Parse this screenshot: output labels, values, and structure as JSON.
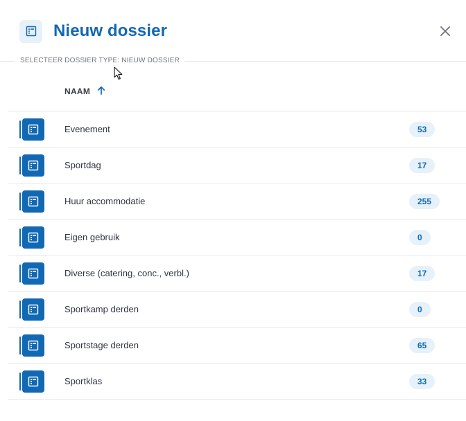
{
  "header": {
    "title": "Nieuw dossier",
    "icon": "dossier-icon",
    "close_icon": "close-icon"
  },
  "section": {
    "label": "SELECTEER DOSSIER TYPE: NIEUW DOSSIER"
  },
  "table": {
    "column_name": "NAAM",
    "sort_icon": "arrow-up-icon",
    "rows": [
      {
        "label": "Evenement",
        "count": "53"
      },
      {
        "label": "Sportdag",
        "count": "17"
      },
      {
        "label": "Huur accommodatie",
        "count": "255"
      },
      {
        "label": "Eigen gebruik",
        "count": "0"
      },
      {
        "label": "Diverse (catering, conc., verbl.)",
        "count": "17"
      },
      {
        "label": "Sportkamp derden",
        "count": "0"
      },
      {
        "label": "Sportstage derden",
        "count": "65"
      },
      {
        "label": "Sportklas",
        "count": "33"
      }
    ]
  },
  "colors": {
    "accent": "#1168b3",
    "badge_bg": "#e6f1fa",
    "divider": "#e6e8eb"
  }
}
